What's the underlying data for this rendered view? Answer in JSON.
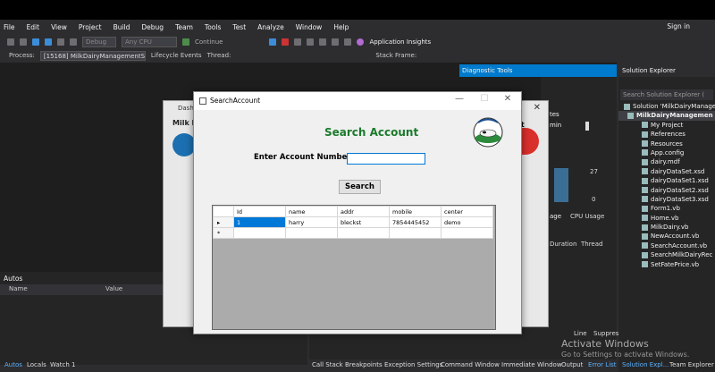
{
  "menu": [
    "File",
    "Edit",
    "View",
    "Project",
    "Build",
    "Debug",
    "Team",
    "Tools",
    "Test",
    "Analyze",
    "Window",
    "Help"
  ],
  "sign_in": "Sign in",
  "toolbar": {
    "config": "Debug",
    "platform": "Any CPU",
    "continue": "Continue",
    "insights": "Application Insights"
  },
  "processbar": {
    "process_label": "Process:",
    "process_value": "[15168] MilkDairyManagementSys",
    "lifecycle": "Lifecycle Events",
    "thread": "Thread:",
    "stack_frame": "Stack Frame:"
  },
  "diagnostic": {
    "title": "Diagnostic Tools",
    "tes": "tes",
    "min": "min",
    "n27": "27",
    "n0": "0",
    "usage": "age",
    "cpu_usage": "CPU Usage",
    "duration": "Duration",
    "thread": "Thread"
  },
  "solution": {
    "title": "Solution Explorer",
    "search": "Search Solution Explorer (",
    "items": [
      {
        "label": "Solution 'MilkDairyManage",
        "sel": false
      },
      {
        "label": "MilkDairyManagemen",
        "sel": true
      },
      {
        "label": "My Project",
        "sel": false
      },
      {
        "label": "References",
        "sel": false
      },
      {
        "label": "Resources",
        "sel": false
      },
      {
        "label": "App.config",
        "sel": false
      },
      {
        "label": "dairy.mdf",
        "sel": false
      },
      {
        "label": "dairyDataSet.xsd",
        "sel": false
      },
      {
        "label": "dairyDataSet1.xsd",
        "sel": false
      },
      {
        "label": "dairyDataSet2.xsd",
        "sel": false
      },
      {
        "label": "dairyDataSet3.xsd",
        "sel": false
      },
      {
        "label": "Form1.vb",
        "sel": false
      },
      {
        "label": "Home.vb",
        "sel": false
      },
      {
        "label": "MilkDairy.vb",
        "sel": false
      },
      {
        "label": "NewAccount.vb",
        "sel": false
      },
      {
        "label": "SearchAccount.vb",
        "sel": false
      },
      {
        "label": "SearchMilkDairyRec",
        "sel": false
      },
      {
        "label": "SetFatePrice.vb",
        "sel": false
      }
    ]
  },
  "autos": {
    "title": "Autos",
    "col_name": "Name",
    "col_value": "Value"
  },
  "bottom_tabs": {
    "autos": "Autos",
    "locals": "Locals",
    "watch": "Watch 1",
    "call_stack": "Call Stack",
    "breakpoints": "Breakpoints",
    "exception": "Exception Settings",
    "command": "Command Window",
    "immediate": "Immediate Window",
    "output": "Output",
    "error": "Error List",
    "sol_exp": "Solution Expl...",
    "team_exp": "Team Explorer"
  },
  "line_tabs": {
    "line": "Line",
    "suppress": "Suppres"
  },
  "watermark": {
    "line1": "Activate Windows",
    "line2": "Go to Settings to activate Windows."
  },
  "dashboard": {
    "title": "Dashb",
    "brand": "Milk D",
    "xit": "xit"
  },
  "search_window": {
    "title": "SearchAccount",
    "heading": "Search Account",
    "label": "Enter Account Number",
    "input_value": "",
    "button": "Search",
    "columns": [
      "Id",
      "name",
      "addr",
      "mobile",
      "center"
    ],
    "rows": [
      [
        "1",
        "harry",
        "bleckst",
        "7854445452",
        "demo"
      ]
    ]
  }
}
